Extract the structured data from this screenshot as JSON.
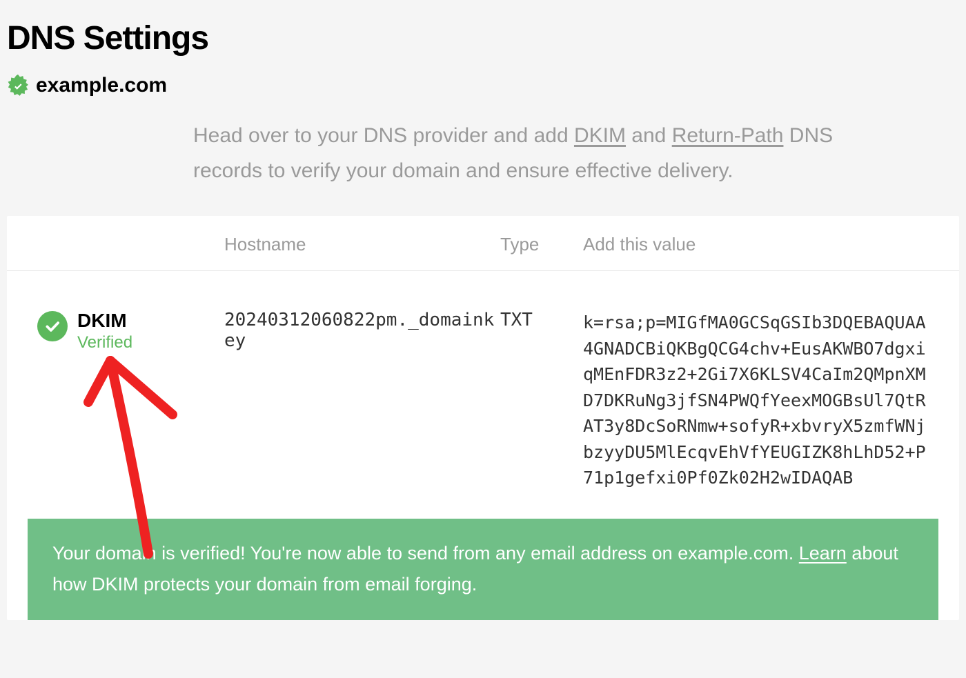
{
  "page": {
    "title": "DNS Settings",
    "domain": "example.com"
  },
  "instructions": {
    "prefix": "Head over to your DNS provider and add ",
    "link1": "DKIM",
    "middle": " and ",
    "link2": "Return-Path",
    "suffix": " DNS records to verify your domain and ensure effective delivery."
  },
  "table": {
    "headers": {
      "hostname": "Hostname",
      "type": "Type",
      "value": "Add this value"
    },
    "record": {
      "name": "DKIM",
      "status": "Verified",
      "hostname": "20240312060822pm._domainkey",
      "type": "TXT",
      "value": "k=rsa;p=MIGfMA0GCSqGSIb3DQEBAQUAA4GNADCBiQKBgQCG4chv+EusAKWBO7dgxiqMEnFDR3z2+2Gi7X6KLSV4CaIm2QMpnXMD7DKRuNg3jfSN4PWQfYeexMOGBsUl7QtRAT3y8DcSoRNmw+sofyR+xbvryX5zmfWNjbzyyDU5MlEcqvEhVfYEUGIZK8hLhD52+P71p1gefxi0Pf0Zk02H2wIDAQAB"
    }
  },
  "banner": {
    "text_prefix": "Your domain is verified! You're now able to send from any email address on example.com. ",
    "learn_link": "Learn",
    "text_suffix": " about how DKIM protects your domain from email forging."
  }
}
